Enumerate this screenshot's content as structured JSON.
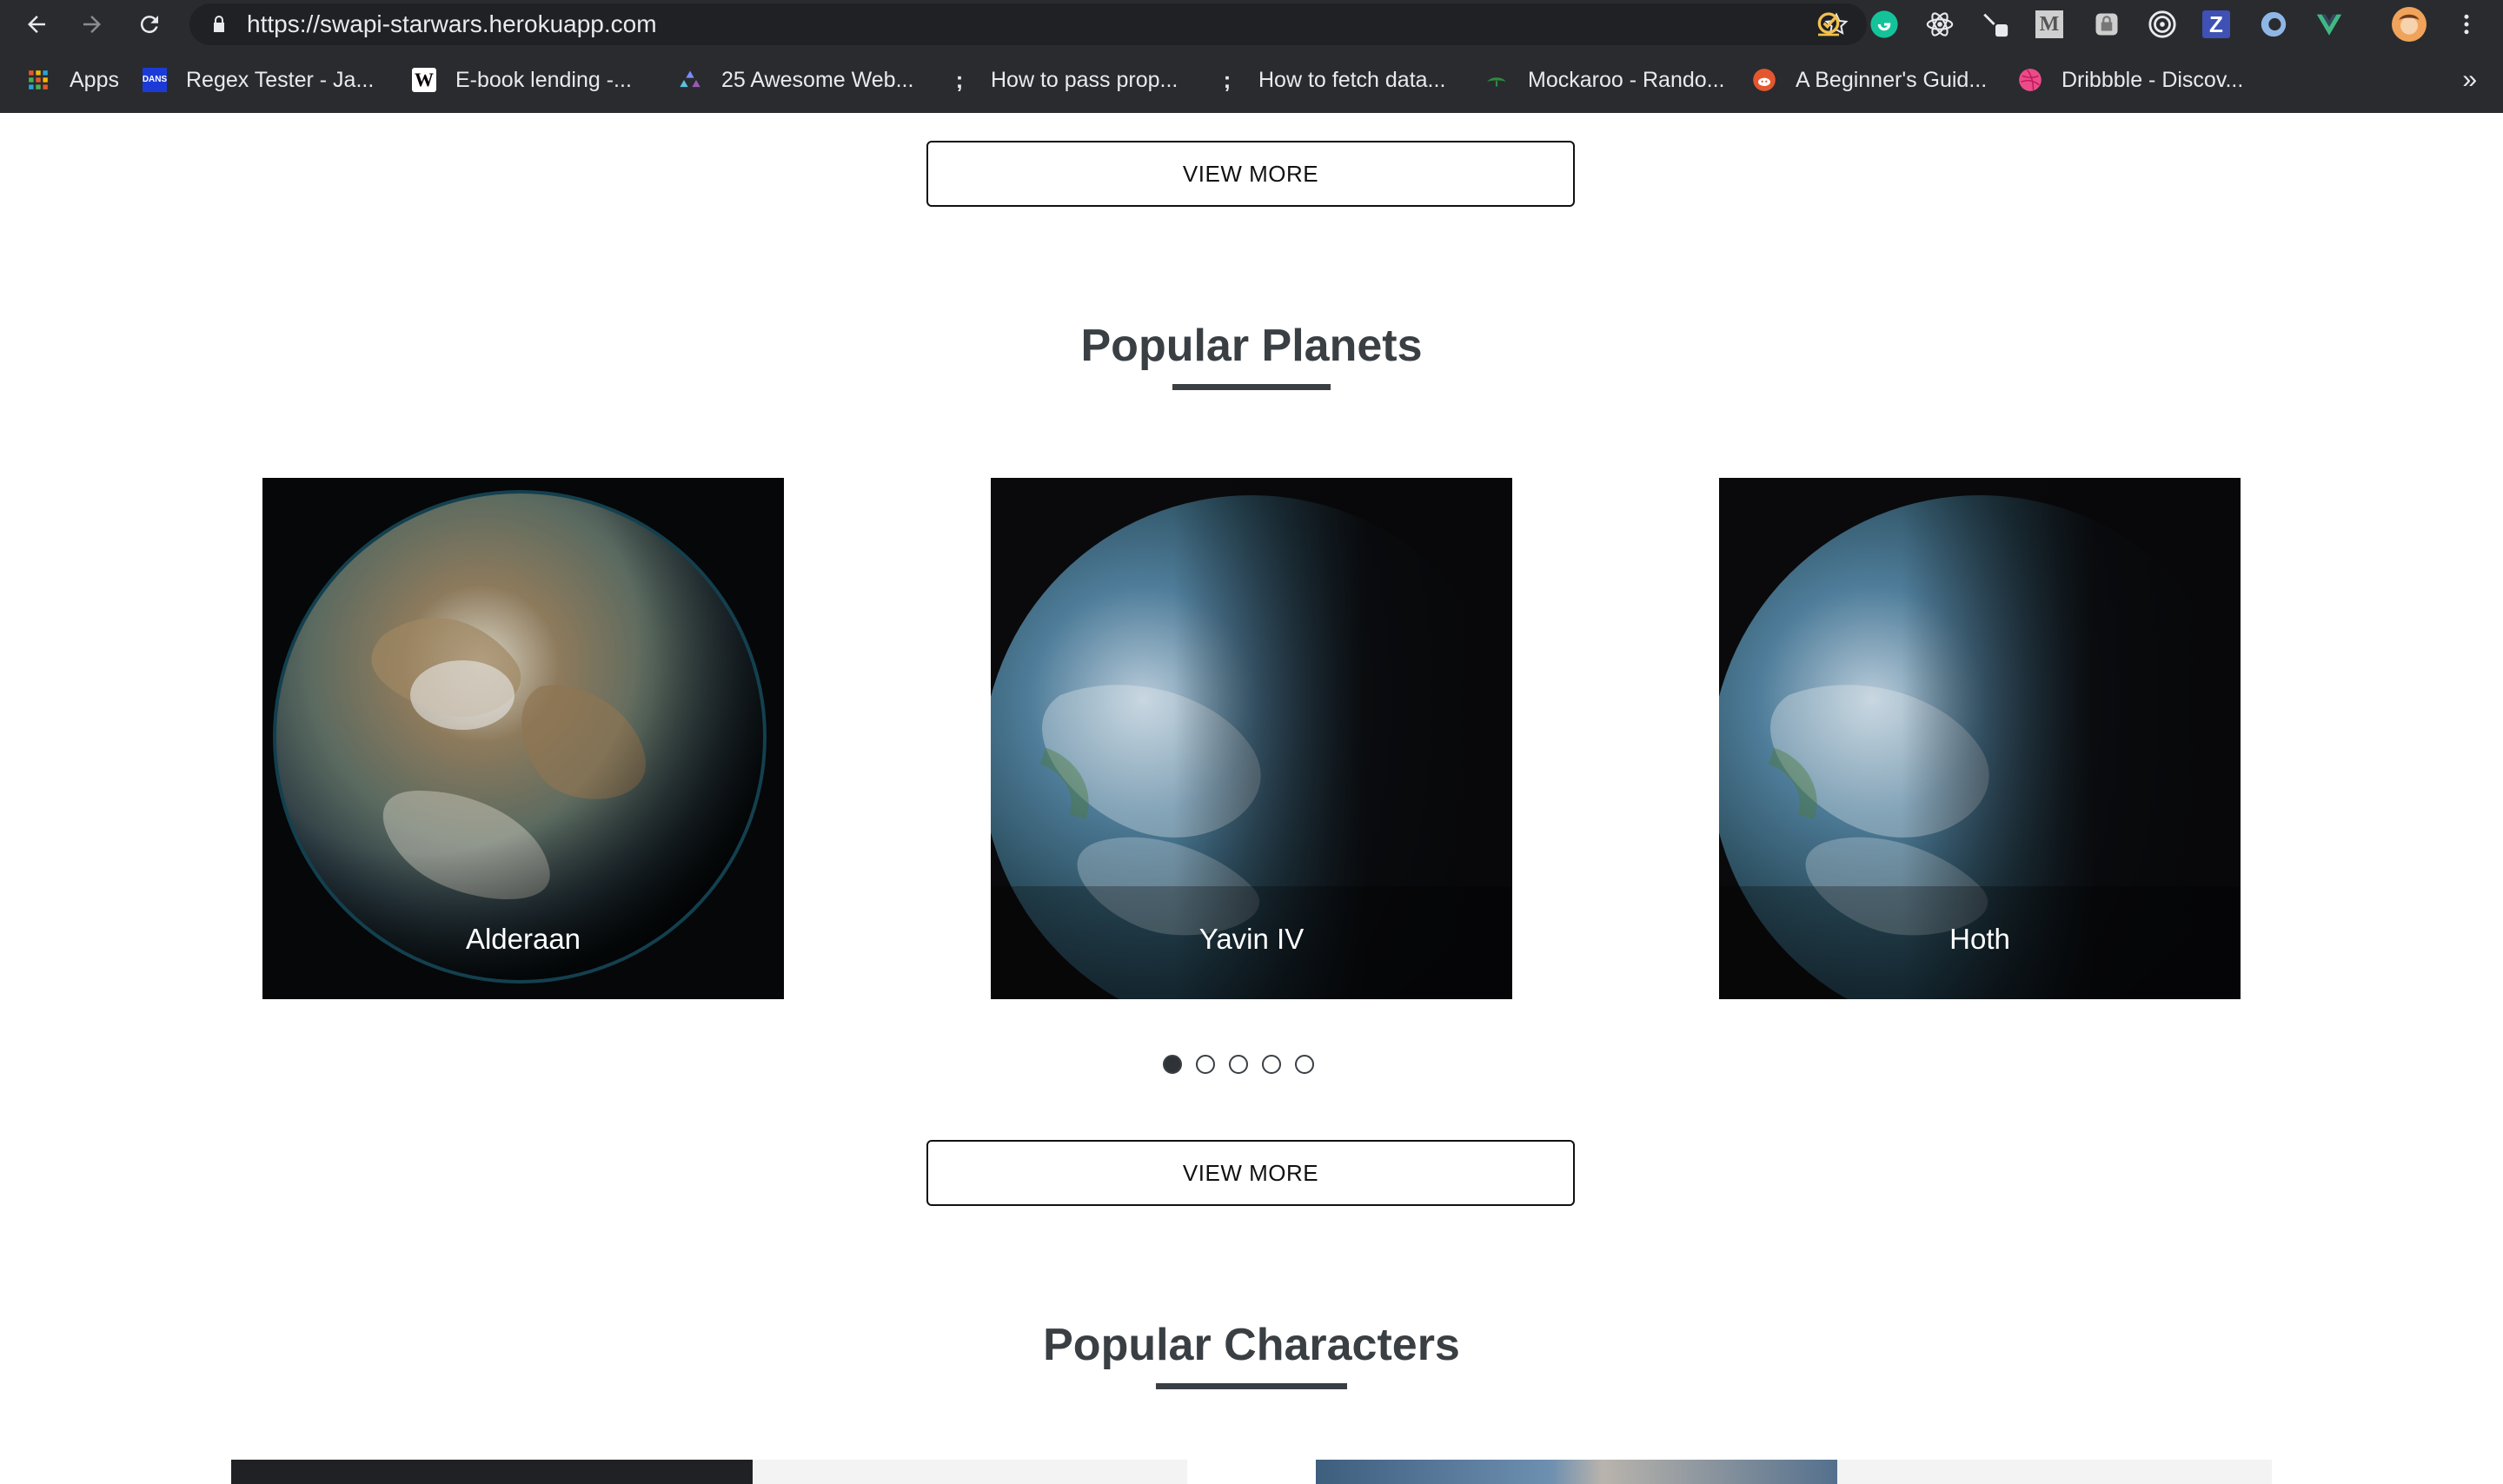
{
  "browser": {
    "url": "https://swapi-starwars.herokuapp.com",
    "bookmarks": [
      {
        "label": "Apps",
        "icon": "apps-grid-icon"
      },
      {
        "label": "Regex Tester - Ja...",
        "icon": "dans-tools-icon",
        "icon_text": "DANS"
      },
      {
        "label": "E-book lending -...",
        "icon": "wikipedia-icon",
        "icon_text": "W"
      },
      {
        "label": "25 Awesome Web...",
        "icon": "triangles-icon"
      },
      {
        "label": "How to pass prop...",
        "icon": "semicolon-icon",
        "icon_text": ";"
      },
      {
        "label": "How to fetch data...",
        "icon": "semicolon-icon",
        "icon_text": ";"
      },
      {
        "label": "Mockaroo - Rando...",
        "icon": "mockaroo-icon"
      },
      {
        "label": "A Beginner's Guid...",
        "icon": "reddit-icon"
      },
      {
        "label": "Dribbble - Discov...",
        "icon": "dribbble-icon"
      }
    ],
    "more_label": "»",
    "extensions": [
      "checkmark-extension-icon",
      "grammarly-icon",
      "react-devtools-icon",
      "pen-extension-icon",
      "medium-icon",
      "lock-extension-icon",
      "target-icon",
      "z-extension-icon",
      "drop-icon",
      "vue-devtools-icon",
      "profile-avatar-icon",
      "menu-kebab-icon"
    ],
    "ext_text": {
      "medium": "M",
      "z": "Z"
    }
  },
  "page": {
    "view_more_top": "VIEW MORE",
    "planets": {
      "title": "Popular Planets",
      "items": [
        {
          "name": "Alderaan",
          "style": "earthlike-brown"
        },
        {
          "name": "Yavin IV",
          "style": "blue-green"
        },
        {
          "name": "Hoth",
          "style": "blue-green"
        }
      ],
      "carousel_pages": 5,
      "active_page": 1
    },
    "view_more_bottom": "VIEW MORE",
    "characters": {
      "title": "Popular Characters"
    }
  },
  "colors": {
    "chrome_bg": "#292b2f",
    "omnibox_bg": "#202124",
    "title_color": "#3a3f44"
  }
}
